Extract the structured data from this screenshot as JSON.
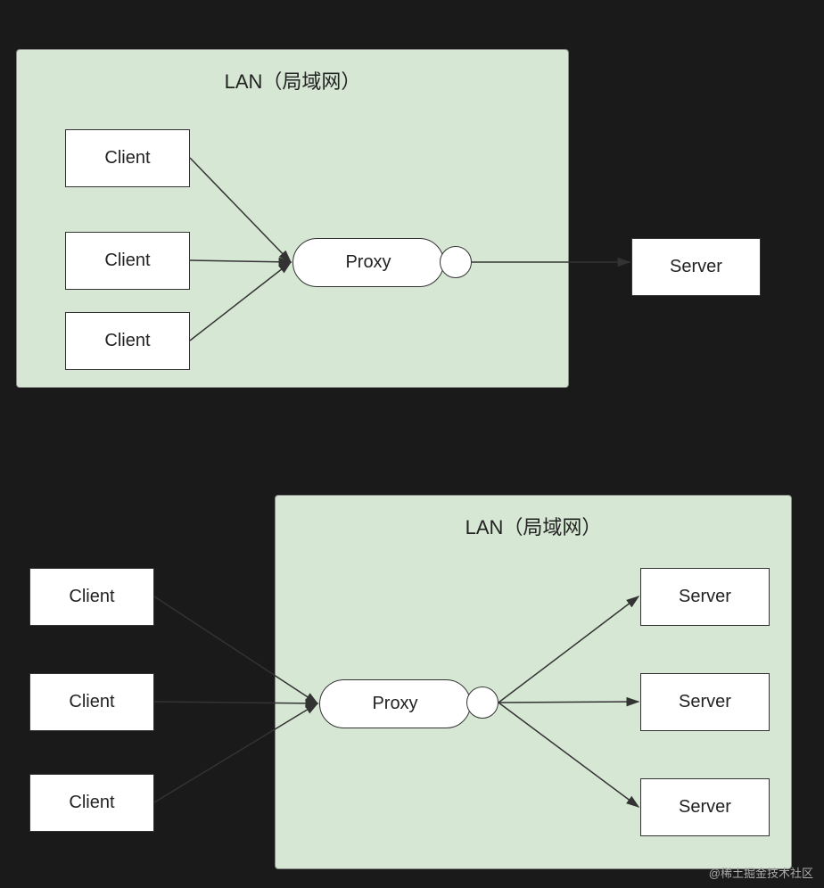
{
  "diagram1": {
    "lan_label": "LAN（局域网）",
    "clients": [
      "Client",
      "Client",
      "Client"
    ],
    "proxy_label": "Proxy",
    "server_label": "Server"
  },
  "diagram2": {
    "lan_label": "LAN（局域网）",
    "clients": [
      "Client",
      "Client",
      "Client"
    ],
    "proxy_label": "Proxy",
    "servers": [
      "Server",
      "Server",
      "Server"
    ]
  },
  "watermark": "@稀土掘金技术社区"
}
